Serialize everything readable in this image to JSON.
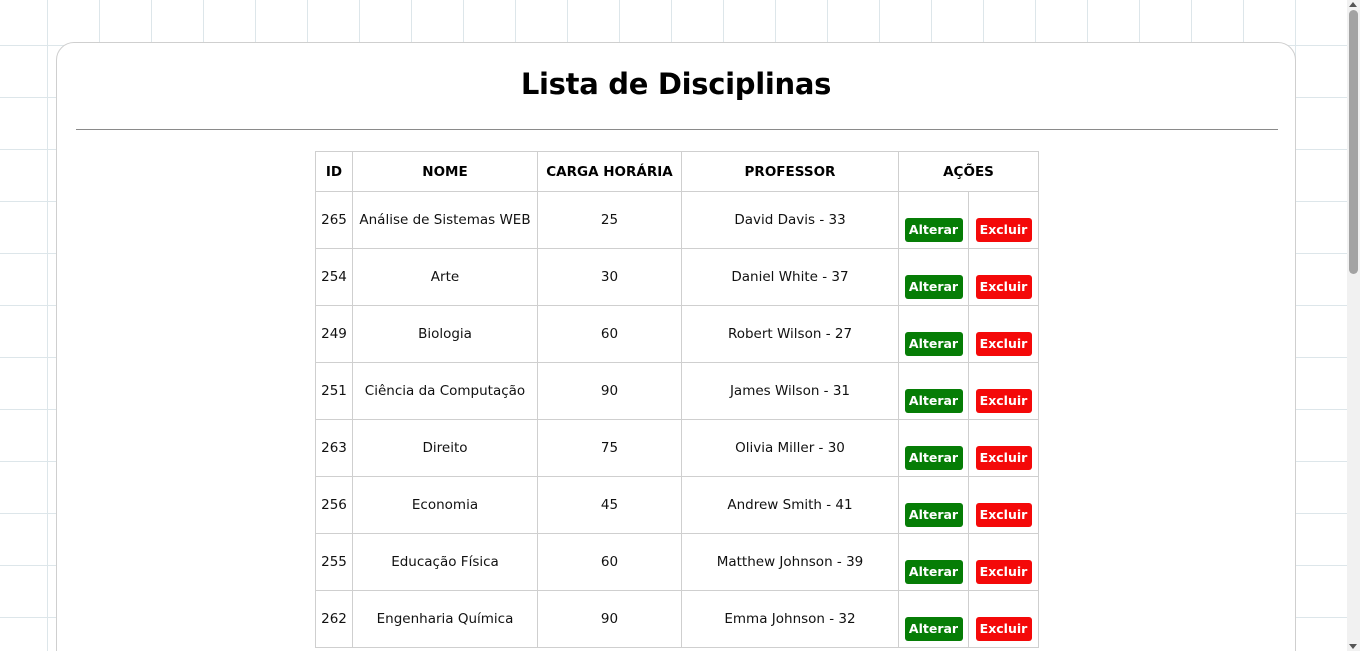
{
  "page": {
    "title": "Lista de Disciplinas"
  },
  "table": {
    "headers": {
      "id": "ID",
      "nome": "NOME",
      "carga": "CARGA HORÁRIA",
      "professor": "PROFESSOR",
      "acoes": "AÇÕES"
    },
    "rows": [
      {
        "id": "265",
        "nome": "Análise de Sistemas WEB",
        "carga": "25",
        "professor": "David Davis - 33"
      },
      {
        "id": "254",
        "nome": "Arte",
        "carga": "30",
        "professor": "Daniel White - 37"
      },
      {
        "id": "249",
        "nome": "Biologia",
        "carga": "60",
        "professor": "Robert Wilson - 27"
      },
      {
        "id": "251",
        "nome": "Ciência da Computação",
        "carga": "90",
        "professor": "James Wilson - 31"
      },
      {
        "id": "263",
        "nome": "Direito",
        "carga": "75",
        "professor": "Olivia Miller - 30"
      },
      {
        "id": "256",
        "nome": "Economia",
        "carga": "45",
        "professor": "Andrew Smith - 41"
      },
      {
        "id": "255",
        "nome": "Educação Física",
        "carga": "60",
        "professor": "Matthew Johnson - 39"
      },
      {
        "id": "262",
        "nome": "Engenharia Química",
        "carga": "90",
        "professor": "Emma Johnson - 32"
      }
    ],
    "actions": {
      "alterar_label": "Alterar",
      "excluir_label": "Excluir"
    }
  },
  "colors": {
    "alterar_button": "#067d06",
    "excluir_button": "#f40909",
    "grid_line": "#dde6ea"
  }
}
